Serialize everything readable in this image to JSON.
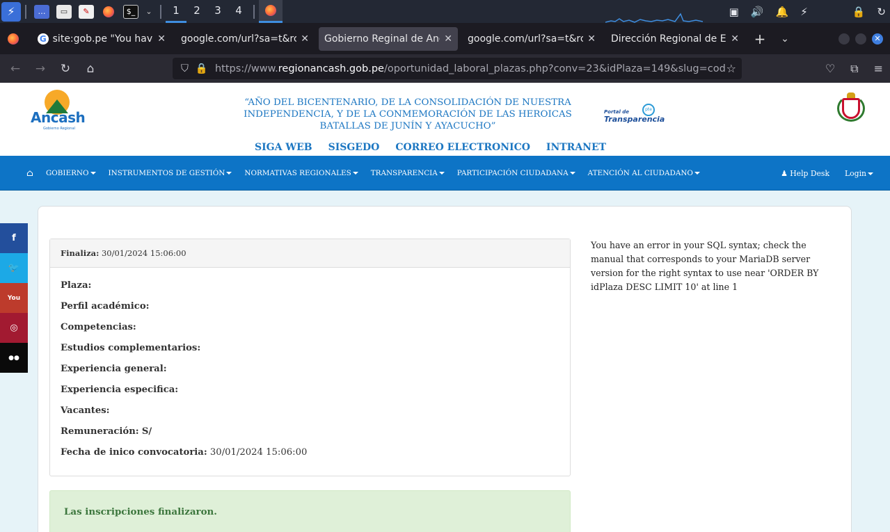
{
  "taskbar": {
    "workspaces": [
      "1",
      "2",
      "3",
      "4"
    ]
  },
  "tabs": [
    {
      "title": "site:gob.pe \"You have a",
      "favicon": "google"
    },
    {
      "title": "google.com/url?sa=t&rct=",
      "favicon": "none"
    },
    {
      "title": "Gobierno Reginal de Ancas",
      "favicon": "none",
      "active": true
    },
    {
      "title": "google.com/url?sa=t&rct=",
      "favicon": "none"
    },
    {
      "title": "Dirección Regional de Edu",
      "favicon": "none"
    }
  ],
  "url": {
    "prefix": "https://www.",
    "host": "regionancash.gob.pe",
    "path": "/oportunidad_laboral_plazas.php?conv=23&idPlaza=149&slug=codigo-n"
  },
  "header": {
    "logo_text": "Ancash",
    "logo_sub": "Gobierno Regional",
    "motto": "“AÑO DEL BICENTENARIO, DE LA CONSOLIDACIÓN DE NUESTRA INDEPENDENCIA, Y DE LA CONMEMORACIÓN DE LAS HEROICAS BATALLAS DE JUNÍN Y AYACUCHO”",
    "transparency_l1": "Portal de",
    "transparency_l2": "Transparencia",
    "transparency_badge": "pte",
    "quicklinks": [
      "SIGA WEB",
      "SISGEDO",
      "CORREO ELECTRONICO",
      "INTRANET"
    ]
  },
  "menu": {
    "items": [
      "GOBIERNO",
      "INSTRUMENTOS DE GESTIÓN",
      "NORMATIVAS REGIONALES",
      "TRANSPARENCIA",
      "PARTICIPACIÓN CIUDADANA",
      "ATENCIÓN AL CIUDADANO"
    ],
    "helpdesk": "Help Desk",
    "login": "Login"
  },
  "social": {
    "facebook": "f",
    "youtube": "You",
    "flickr": "●●"
  },
  "panel": {
    "finaliza_label": "Finaliza:",
    "finaliza_value": "30/01/2024 15:06:00",
    "fields": [
      {
        "label": "Plaza:",
        "value": ""
      },
      {
        "label": "Perfil académico:",
        "value": ""
      },
      {
        "label": "Competencias:",
        "value": ""
      },
      {
        "label": "Estudios complementarios:",
        "value": ""
      },
      {
        "label": "Experiencia general:",
        "value": ""
      },
      {
        "label": "Experiencia especifica:",
        "value": ""
      },
      {
        "label": "Vacantes:",
        "value": ""
      },
      {
        "label": "Remuneración:",
        "value": "S/"
      },
      {
        "label": "Fecha de inico convocatoria:",
        "value": "30/01/2024 15:06:00"
      }
    ]
  },
  "alert": "Las inscripciones finalizaron.",
  "error_message": "You have an error in your SQL syntax; check the manual that corresponds to your MariaDB server version for the right syntax to use near 'ORDER BY idPlaza DESC LIMIT 10' at line 1",
  "colors": {
    "menu_bg": "#0d74c6",
    "link_blue": "#1d77c2",
    "alert_bg": "#dff0d8",
    "page_bg": "#e6f3f8"
  }
}
